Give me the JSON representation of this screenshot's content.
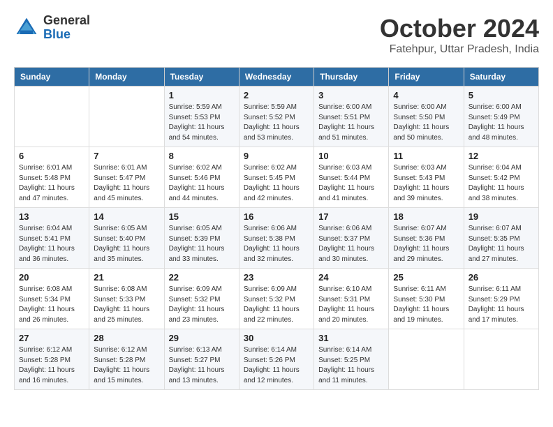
{
  "header": {
    "logo_line1": "General",
    "logo_line2": "Blue",
    "month_title": "October 2024",
    "location": "Fatehpur, Uttar Pradesh, India"
  },
  "weekdays": [
    "Sunday",
    "Monday",
    "Tuesday",
    "Wednesday",
    "Thursday",
    "Friday",
    "Saturday"
  ],
  "weeks": [
    [
      {
        "day": null,
        "info": null
      },
      {
        "day": null,
        "info": null
      },
      {
        "day": "1",
        "info": "Sunrise: 5:59 AM\nSunset: 5:53 PM\nDaylight: 11 hours and 54 minutes."
      },
      {
        "day": "2",
        "info": "Sunrise: 5:59 AM\nSunset: 5:52 PM\nDaylight: 11 hours and 53 minutes."
      },
      {
        "day": "3",
        "info": "Sunrise: 6:00 AM\nSunset: 5:51 PM\nDaylight: 11 hours and 51 minutes."
      },
      {
        "day": "4",
        "info": "Sunrise: 6:00 AM\nSunset: 5:50 PM\nDaylight: 11 hours and 50 minutes."
      },
      {
        "day": "5",
        "info": "Sunrise: 6:00 AM\nSunset: 5:49 PM\nDaylight: 11 hours and 48 minutes."
      }
    ],
    [
      {
        "day": "6",
        "info": "Sunrise: 6:01 AM\nSunset: 5:48 PM\nDaylight: 11 hours and 47 minutes."
      },
      {
        "day": "7",
        "info": "Sunrise: 6:01 AM\nSunset: 5:47 PM\nDaylight: 11 hours and 45 minutes."
      },
      {
        "day": "8",
        "info": "Sunrise: 6:02 AM\nSunset: 5:46 PM\nDaylight: 11 hours and 44 minutes."
      },
      {
        "day": "9",
        "info": "Sunrise: 6:02 AM\nSunset: 5:45 PM\nDaylight: 11 hours and 42 minutes."
      },
      {
        "day": "10",
        "info": "Sunrise: 6:03 AM\nSunset: 5:44 PM\nDaylight: 11 hours and 41 minutes."
      },
      {
        "day": "11",
        "info": "Sunrise: 6:03 AM\nSunset: 5:43 PM\nDaylight: 11 hours and 39 minutes."
      },
      {
        "day": "12",
        "info": "Sunrise: 6:04 AM\nSunset: 5:42 PM\nDaylight: 11 hours and 38 minutes."
      }
    ],
    [
      {
        "day": "13",
        "info": "Sunrise: 6:04 AM\nSunset: 5:41 PM\nDaylight: 11 hours and 36 minutes."
      },
      {
        "day": "14",
        "info": "Sunrise: 6:05 AM\nSunset: 5:40 PM\nDaylight: 11 hours and 35 minutes."
      },
      {
        "day": "15",
        "info": "Sunrise: 6:05 AM\nSunset: 5:39 PM\nDaylight: 11 hours and 33 minutes."
      },
      {
        "day": "16",
        "info": "Sunrise: 6:06 AM\nSunset: 5:38 PM\nDaylight: 11 hours and 32 minutes."
      },
      {
        "day": "17",
        "info": "Sunrise: 6:06 AM\nSunset: 5:37 PM\nDaylight: 11 hours and 30 minutes."
      },
      {
        "day": "18",
        "info": "Sunrise: 6:07 AM\nSunset: 5:36 PM\nDaylight: 11 hours and 29 minutes."
      },
      {
        "day": "19",
        "info": "Sunrise: 6:07 AM\nSunset: 5:35 PM\nDaylight: 11 hours and 27 minutes."
      }
    ],
    [
      {
        "day": "20",
        "info": "Sunrise: 6:08 AM\nSunset: 5:34 PM\nDaylight: 11 hours and 26 minutes."
      },
      {
        "day": "21",
        "info": "Sunrise: 6:08 AM\nSunset: 5:33 PM\nDaylight: 11 hours and 25 minutes."
      },
      {
        "day": "22",
        "info": "Sunrise: 6:09 AM\nSunset: 5:32 PM\nDaylight: 11 hours and 23 minutes."
      },
      {
        "day": "23",
        "info": "Sunrise: 6:09 AM\nSunset: 5:32 PM\nDaylight: 11 hours and 22 minutes."
      },
      {
        "day": "24",
        "info": "Sunrise: 6:10 AM\nSunset: 5:31 PM\nDaylight: 11 hours and 20 minutes."
      },
      {
        "day": "25",
        "info": "Sunrise: 6:11 AM\nSunset: 5:30 PM\nDaylight: 11 hours and 19 minutes."
      },
      {
        "day": "26",
        "info": "Sunrise: 6:11 AM\nSunset: 5:29 PM\nDaylight: 11 hours and 17 minutes."
      }
    ],
    [
      {
        "day": "27",
        "info": "Sunrise: 6:12 AM\nSunset: 5:28 PM\nDaylight: 11 hours and 16 minutes."
      },
      {
        "day": "28",
        "info": "Sunrise: 6:12 AM\nSunset: 5:28 PM\nDaylight: 11 hours and 15 minutes."
      },
      {
        "day": "29",
        "info": "Sunrise: 6:13 AM\nSunset: 5:27 PM\nDaylight: 11 hours and 13 minutes."
      },
      {
        "day": "30",
        "info": "Sunrise: 6:14 AM\nSunset: 5:26 PM\nDaylight: 11 hours and 12 minutes."
      },
      {
        "day": "31",
        "info": "Sunrise: 6:14 AM\nSunset: 5:25 PM\nDaylight: 11 hours and 11 minutes."
      },
      {
        "day": null,
        "info": null
      },
      {
        "day": null,
        "info": null
      }
    ]
  ]
}
